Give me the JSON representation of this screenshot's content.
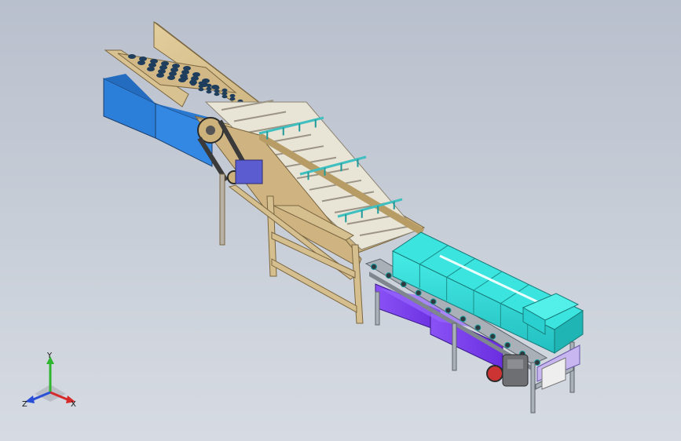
{
  "view": {
    "background_top": "#b9c0cd",
    "background_bottom": "#d6dbe3"
  },
  "triad": {
    "x_label": "X",
    "y_label": "Y",
    "z_label": "Z",
    "x_color": "#d62a2a",
    "y_color": "#2fb52f",
    "z_color": "#2a4fd6"
  },
  "colors": {
    "wood_frame": "#d6bf8e",
    "wood_dark": "#a88e5a",
    "hopper_blue": "#2c7fd9",
    "belt_white": "#f2f2ee",
    "tank_cyan": "#34dbd6",
    "basin_purple": "#7a3cf0",
    "steel": "#9aa3ad",
    "motor_gray": "#6d6f73"
  }
}
